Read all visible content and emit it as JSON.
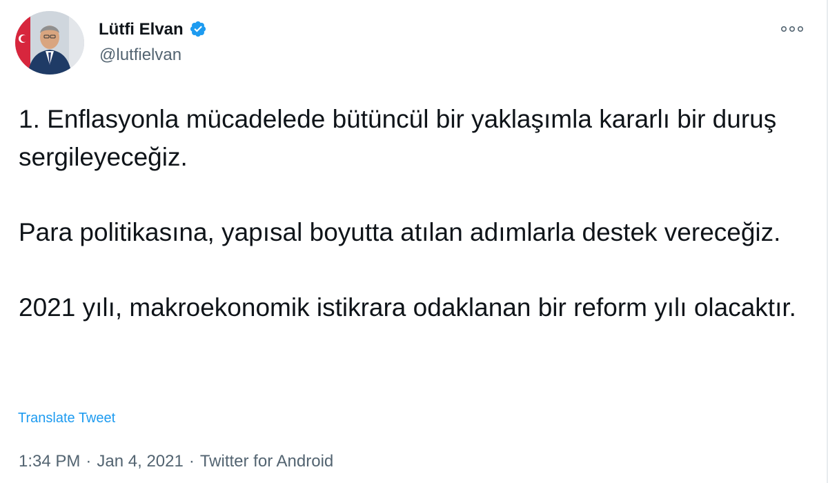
{
  "author": {
    "display_name": "Lütfi Elvan",
    "handle": "@lutfielvan",
    "verified": true,
    "verified_color": "#1d9bf0"
  },
  "menu": {
    "icon": "more-icon"
  },
  "tweet": {
    "paragraphs": [
      "1. Enflasyonla mücadelede bütüncül bir yaklaşımla kararlı bir duruş sergileyeceğiz.",
      "Para politikasına, yapısal boyutta atılan adımlarla destek vereceğiz.",
      "2021 yılı, makroekonomik istikrara odaklanan bir reform yılı olacaktır."
    ],
    "translate_label": "Translate Tweet"
  },
  "meta": {
    "time": "1:34 PM",
    "date": "Jan 4, 2021",
    "source": "Twitter for Android",
    "separator": "·"
  },
  "colors": {
    "text": "#0f1419",
    "secondary": "#536471",
    "link": "#1d9bf0"
  }
}
